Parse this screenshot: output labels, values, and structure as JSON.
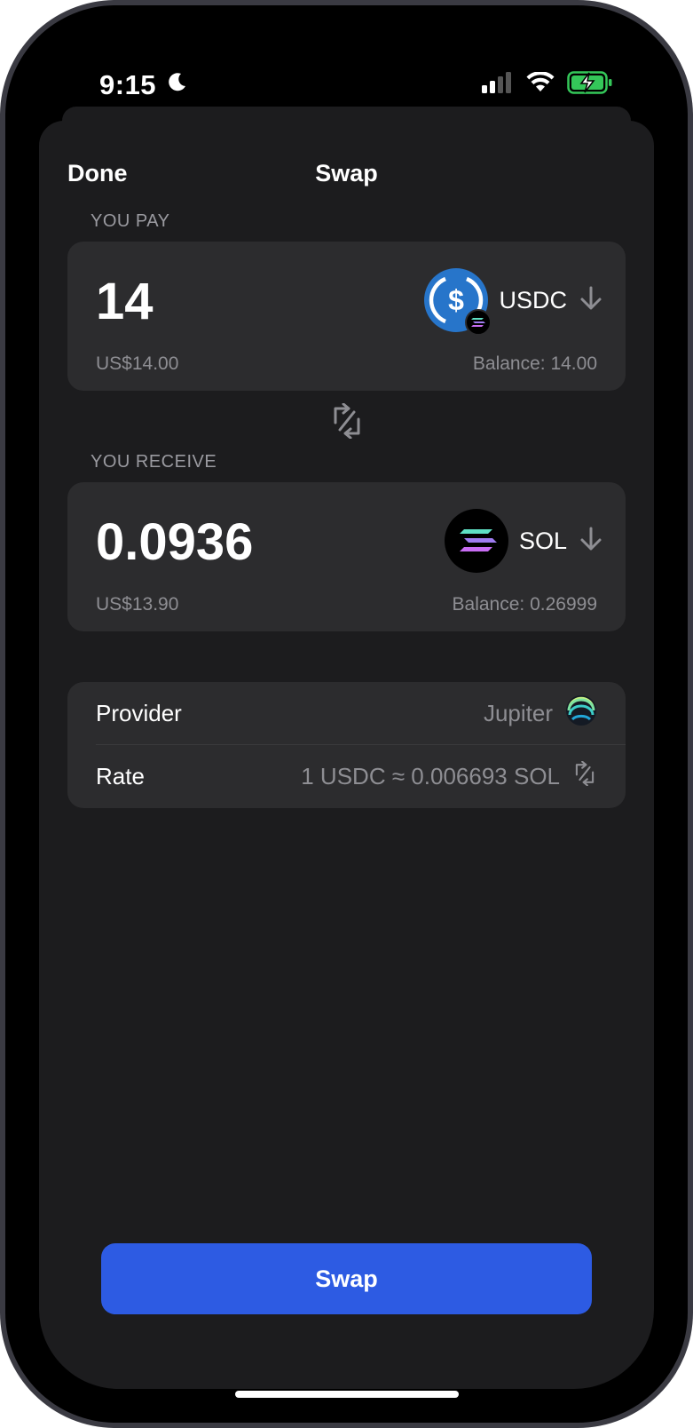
{
  "status_bar": {
    "time": "9:15"
  },
  "nav": {
    "done_label": "Done",
    "title": "Swap"
  },
  "pay": {
    "label": "YOU PAY",
    "amount": "14",
    "fiat": "US$14.00",
    "balance": "Balance: 14.00",
    "token": "USDC",
    "token_icon": "usdc-icon",
    "network_badge_icon": "solana-icon"
  },
  "receive": {
    "label": "YOU RECEIVE",
    "amount": "0.0936",
    "fiat": "US$13.90",
    "balance": "Balance: 0.26999",
    "token": "SOL",
    "token_icon": "solana-icon"
  },
  "info": {
    "provider_label": "Provider",
    "provider_value": "Jupiter",
    "rate_label": "Rate",
    "rate_value": "1 USDC ≈ 0.006693 SOL"
  },
  "action": {
    "swap_label": "Swap"
  },
  "colors": {
    "accent": "#2d5be3",
    "usdc": "#2775ca",
    "card": "#2c2c2e",
    "sheet": "#1c1c1e",
    "battery": "#34c759"
  }
}
